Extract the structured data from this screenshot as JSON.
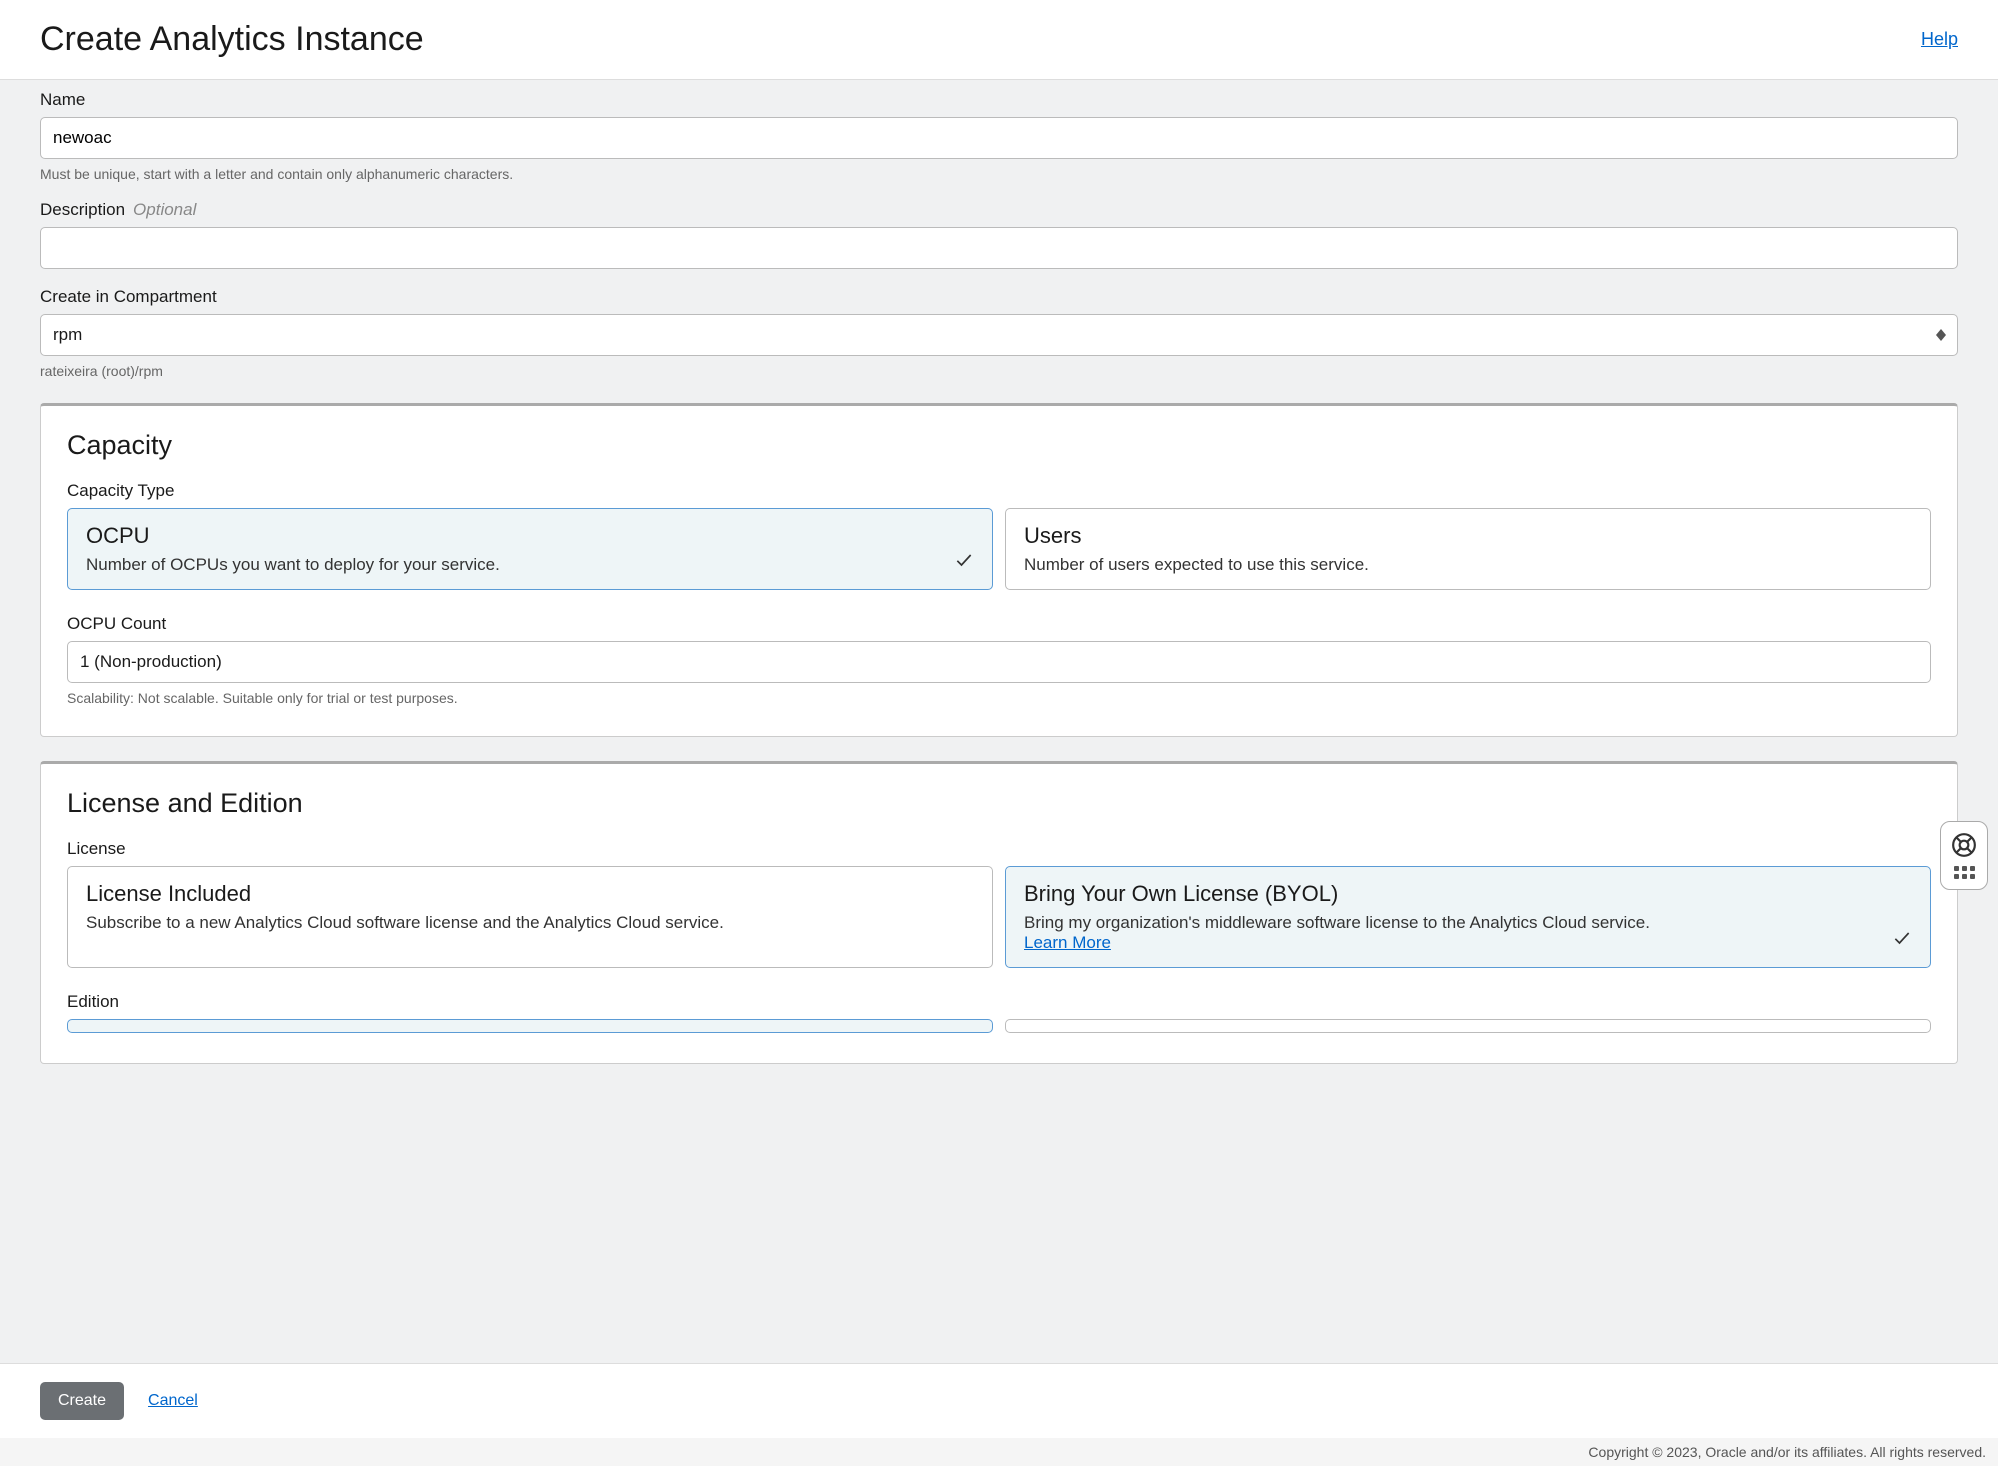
{
  "header": {
    "title": "Create Analytics Instance",
    "help_label": "Help"
  },
  "name": {
    "label": "Name",
    "value": "newoac",
    "helper": "Must be unique, start with a letter and contain only alphanumeric characters."
  },
  "description": {
    "label": "Description",
    "optional": "Optional",
    "value": ""
  },
  "compartment": {
    "label": "Create in Compartment",
    "value": "rpm",
    "path": "rateixeira (root)/rpm"
  },
  "capacity": {
    "title": "Capacity",
    "type_label": "Capacity Type",
    "ocpu": {
      "title": "OCPU",
      "desc": "Number of OCPUs you want to deploy for your service."
    },
    "users": {
      "title": "Users",
      "desc": "Number of users expected to use this service."
    },
    "count": {
      "label": "OCPU Count",
      "value": "1 (Non-production)",
      "helper": "Scalability: Not scalable. Suitable only for trial or test purposes."
    }
  },
  "license": {
    "title": "License and Edition",
    "license_label": "License",
    "included": {
      "title": "License Included",
      "desc": "Subscribe to a new Analytics Cloud software license and the Analytics Cloud service."
    },
    "byol": {
      "title": "Bring Your Own License (BYOL)",
      "desc": "Bring my organization's middleware software license to the Analytics Cloud service.",
      "learn_more": "Learn More"
    },
    "edition_label": "Edition"
  },
  "footer": {
    "create_label": "Create",
    "cancel_label": "Cancel",
    "copyright": "Copyright © 2023, Oracle and/or its affiliates. All rights reserved."
  }
}
